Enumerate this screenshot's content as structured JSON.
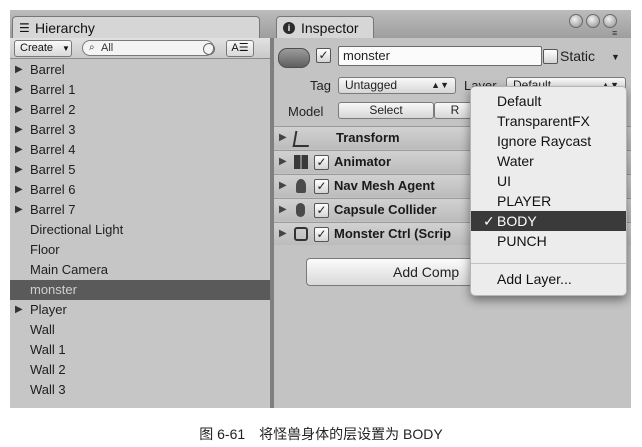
{
  "hierarchy": {
    "tab_label": "Hierarchy",
    "create_label": "Create",
    "search_placeholder": "All",
    "items": [
      {
        "label": "Barrel",
        "expandable": true
      },
      {
        "label": "Barrel 1",
        "expandable": true
      },
      {
        "label": "Barrel 2",
        "expandable": true
      },
      {
        "label": "Barrel 3",
        "expandable": true
      },
      {
        "label": "Barrel 4",
        "expandable": true
      },
      {
        "label": "Barrel 5",
        "expandable": true
      },
      {
        "label": "Barrel 6",
        "expandable": true
      },
      {
        "label": "Barrel 7",
        "expandable": true
      },
      {
        "label": "Directional Light",
        "expandable": false
      },
      {
        "label": "Floor",
        "expandable": false
      },
      {
        "label": "Main Camera",
        "expandable": false
      },
      {
        "label": "monster",
        "expandable": false,
        "selected": true
      },
      {
        "label": "Player",
        "expandable": true
      },
      {
        "label": "Wall",
        "expandable": false
      },
      {
        "label": "Wall 1",
        "expandable": false
      },
      {
        "label": "Wall 2",
        "expandable": false
      },
      {
        "label": "Wall 3",
        "expandable": false
      }
    ]
  },
  "inspector": {
    "tab_label": "Inspector",
    "object_name": "monster",
    "static_label": "Static",
    "tag_label": "Tag",
    "tag_value": "Untagged",
    "layer_label": "Layer",
    "layer_value": "Default",
    "model_label": "Model",
    "model_buttons": [
      "Select",
      "R"
    ],
    "components": [
      {
        "name": "Transform",
        "icon": "transform-icon",
        "has_checkbox": false
      },
      {
        "name": "Animator",
        "icon": "animator-icon",
        "has_checkbox": true
      },
      {
        "name": "Nav Mesh Agent",
        "icon": "nav-agent-icon",
        "has_checkbox": true
      },
      {
        "name": "Capsule Collider",
        "icon": "capsule-icon",
        "has_checkbox": true
      },
      {
        "name": "Monster Ctrl (Scrip",
        "icon": "script-icon",
        "has_checkbox": true
      }
    ],
    "add_component_label": "Add Comp"
  },
  "layer_menu": {
    "items": [
      "Default",
      "TransparentFX",
      "Ignore Raycast",
      "Water",
      "UI",
      "PLAYER",
      "BODY",
      "PUNCH"
    ],
    "selected": "BODY",
    "check_mark": "✓",
    "add_layer_label": "Add Layer..."
  },
  "caption": {
    "number": "图 6-61",
    "text": "将怪兽身体的层设置为 BODY"
  }
}
